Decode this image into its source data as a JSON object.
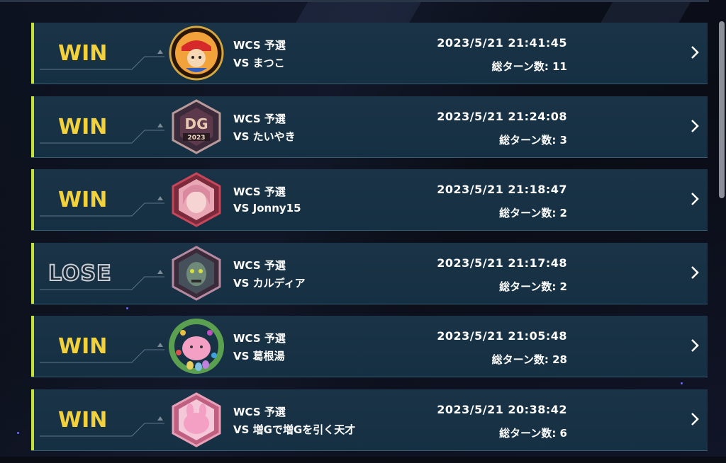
{
  "matches": [
    {
      "result": "WIN",
      "mode": "WCS 予選",
      "opponent": "VS まつこ",
      "datetime": "2023/5/21 21:41:45",
      "turns": "総ターン数: 11"
    },
    {
      "result": "WIN",
      "mode": "WCS 予選",
      "opponent": "VS たいやき",
      "datetime": "2023/5/21 21:24:08",
      "turns": "総ターン数: 3"
    },
    {
      "result": "WIN",
      "mode": "WCS 予選",
      "opponent": "VS Jonny15",
      "datetime": "2023/5/21 21:18:47",
      "turns": "総ターン数: 2"
    },
    {
      "result": "LOSE",
      "mode": "WCS 予選",
      "opponent": "VS カルディア",
      "datetime": "2023/5/21 21:17:48",
      "turns": "総ターン数: 2"
    },
    {
      "result": "WIN",
      "mode": "WCS 予選",
      "opponent": "VS 葛根湯",
      "datetime": "2023/5/21 21:05:48",
      "turns": "総ターン数: 28"
    },
    {
      "result": "WIN",
      "mode": "WCS 予選",
      "opponent": "VS 増Gで増Gを引く天才",
      "datetime": "2023/5/21 20:38:42",
      "turns": "総ターン数: 6"
    }
  ],
  "avatar_icons": [
    "baseball-player-badge-icon",
    "dg-2023-emblem-icon",
    "anime-girl-portrait-icon",
    "zombie-face-icon",
    "pink-bunny-wreath-icon",
    "pink-bunny-icon"
  ],
  "colors": {
    "win": "#f3d13a",
    "lose_outline": "#c9ced6",
    "accent_bar": "#c6e23a",
    "row_bg": "#183145"
  }
}
